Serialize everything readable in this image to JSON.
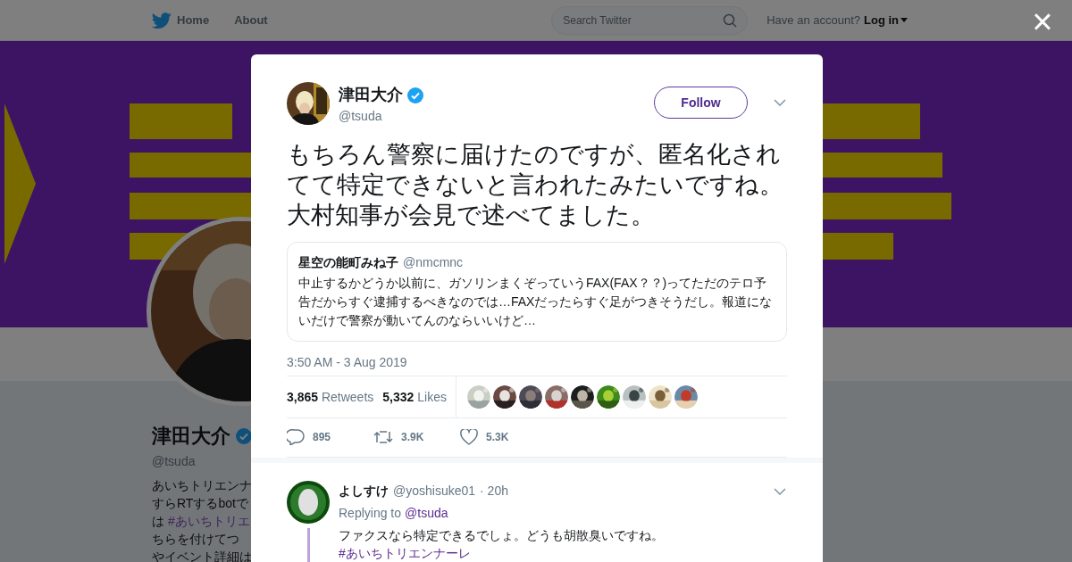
{
  "topbar": {
    "nav": [
      "Home",
      "About"
    ],
    "search": {
      "placeholder": "Search Twitter"
    },
    "account_prompt": "Have an account?",
    "login": "Log in"
  },
  "banner": {
    "kind": "picture"
  },
  "profile": {
    "avatar": {
      "kind": "picture"
    },
    "name": "津田大介",
    "verified": true,
    "handle": "@tsuda",
    "bio_lines": [
      [
        {
          "kind": "text",
          "text": "あいちトリエンナ"
        }
      ],
      [
        {
          "kind": "text",
          "text": "すらRTするbotで"
        }
      ],
      [
        {
          "kind": "text",
          "text": "は"
        },
        {
          "kind": "hashtag",
          "text": "#あいちトリエ"
        }
      ],
      [
        {
          "kind": "text",
          "text": "ちらを付けてつ"
        }
      ],
      [
        {
          "kind": "text",
          "text": "やイベント詳細は"
        }
      ]
    ]
  },
  "close": "×",
  "tweet": {
    "avatar": {
      "kind": "picture"
    },
    "name": "津田大介",
    "verified": true,
    "handle": "@tsuda",
    "follow": "Follow",
    "text": "もちろん警察に届けたのですが、匿名化されてて特定できないと言われたみたいですね。大村知事が会見で述べてました。",
    "quote": {
      "name": "星空の能町みね子",
      "handle": "@nmcmnc",
      "text": "中止するかどうか以前に、ガソリンまくぞっていうFAX(FAX？？)ってただのテロ予告だからすぐ逮捕するべきなのでは…FAXだったらすぐ足がつきそうだし。報道にないだけで警察が動いてんのならいいけど…"
    },
    "timestamp": "3:50 AM - 3 Aug 2019",
    "retweets": {
      "count": "3,865",
      "label": "Retweets"
    },
    "likes": {
      "count": "5,332",
      "label": "Likes"
    },
    "liker_avatars": [
      {
        "kind": "picture"
      },
      {
        "kind": "picture"
      },
      {
        "kind": "picture"
      },
      {
        "kind": "picture"
      },
      {
        "kind": "picture"
      },
      {
        "kind": "picture"
      },
      {
        "kind": "picture"
      },
      {
        "kind": "picture"
      },
      {
        "kind": "picture"
      }
    ],
    "actions": [
      {
        "kind": "reply",
        "count": "895"
      },
      {
        "kind": "retweet",
        "count": "3.9K"
      },
      {
        "kind": "like",
        "count": "5.3K"
      }
    ]
  },
  "reply": {
    "avatar": {
      "kind": "picture"
    },
    "name": "よしすけ",
    "handle": "@yoshisuke01",
    "time": "· 20h",
    "replying_to": "Replying to",
    "replying_handle": "@tsuda",
    "text": "ファクスなら特定できるでしょ。どうも胡散臭いですね。",
    "hashtag": "#あいちトリエンナーレ"
  }
}
